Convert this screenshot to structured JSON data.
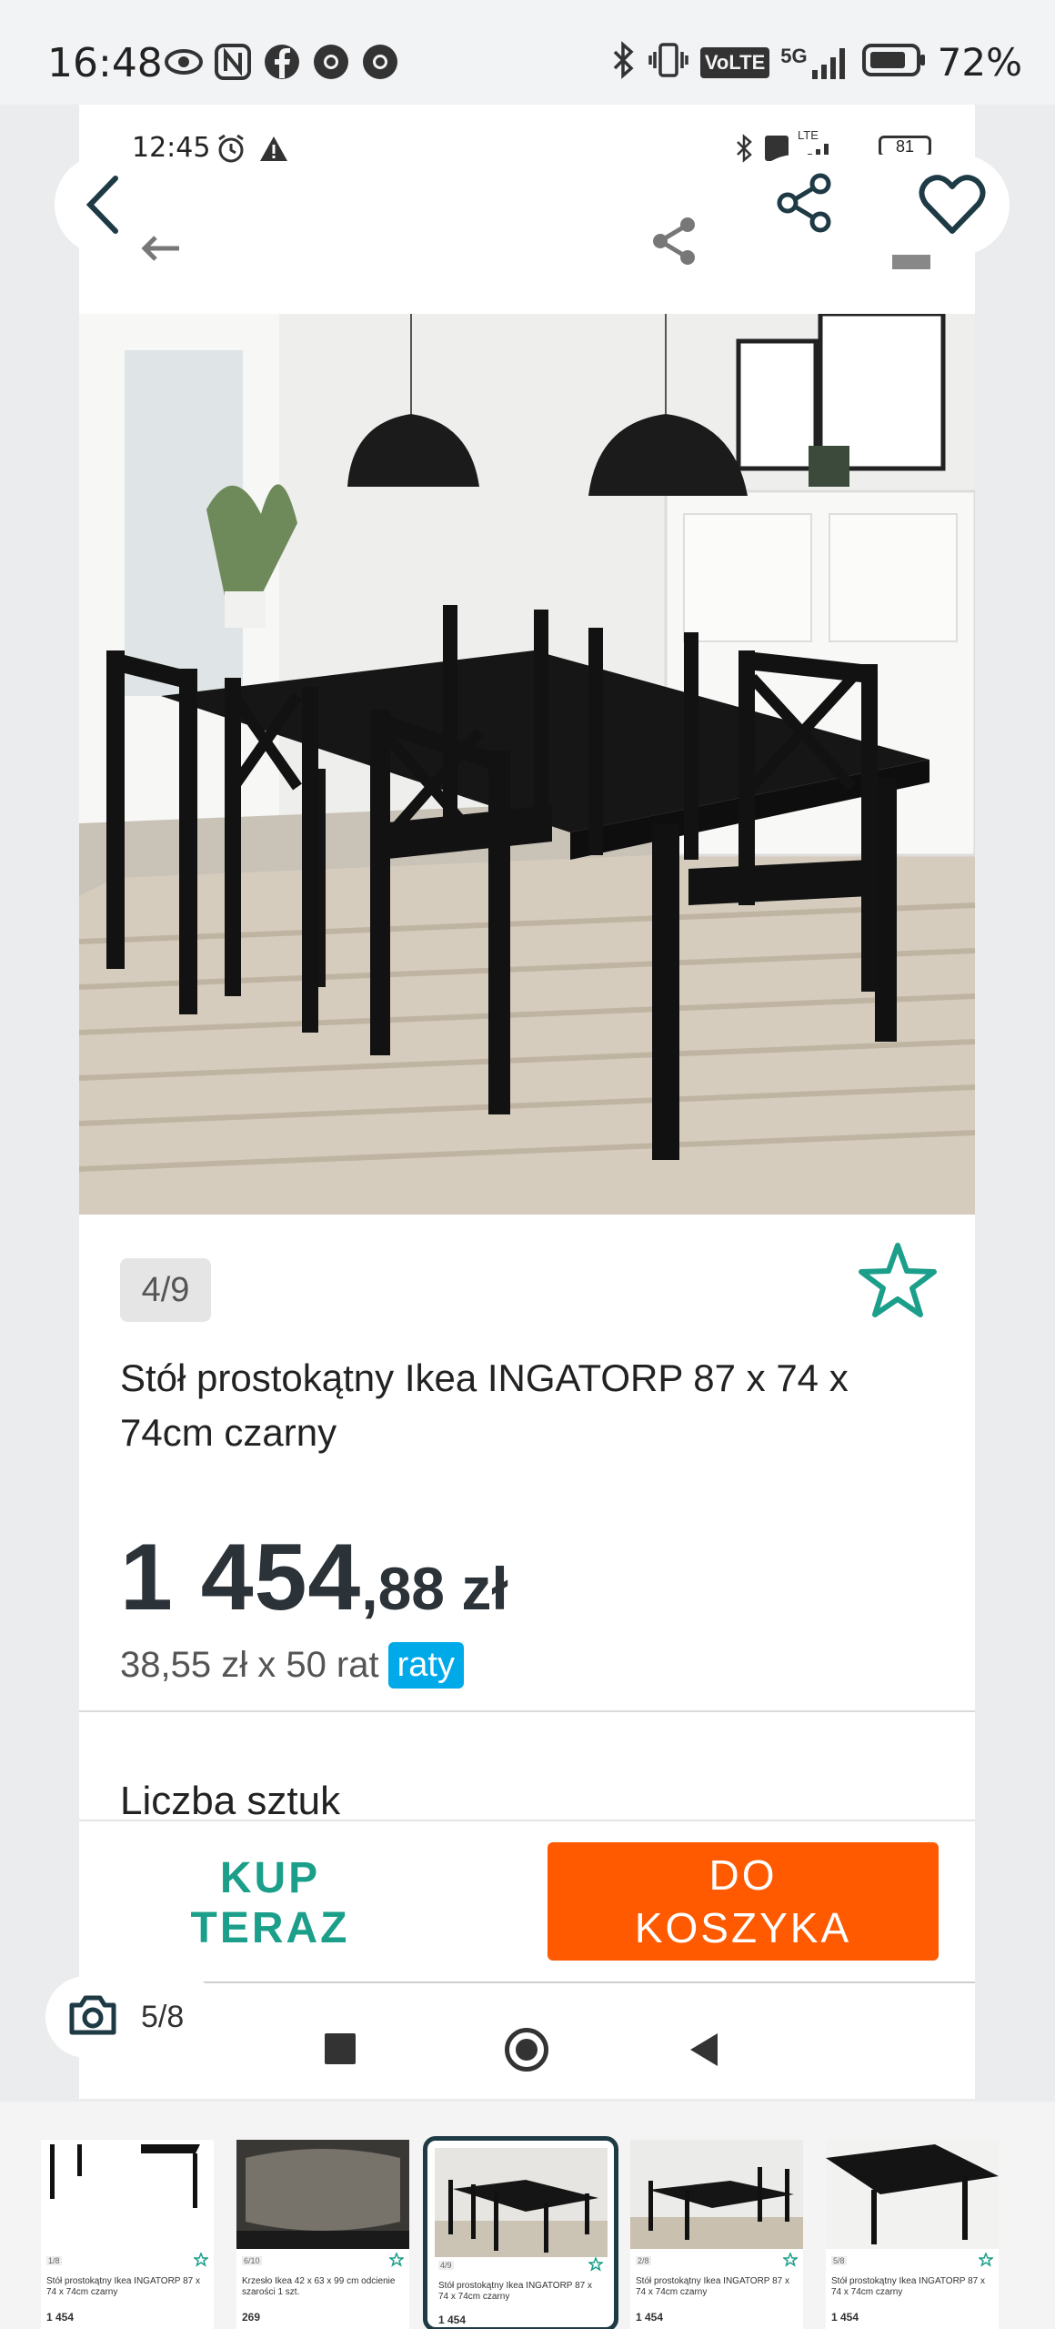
{
  "status_bar": {
    "time": "16:48",
    "left_icons": [
      "eye-icon",
      "nfc-icon",
      "facebook-icon",
      "chrome-icon",
      "chrome-icon"
    ],
    "right_icons": [
      "bluetooth-icon",
      "vibrate-icon",
      "volte-icon",
      "signal-5g-icon",
      "battery-icon"
    ],
    "volte": "VoLTE",
    "network": "5G",
    "battery": "72%"
  },
  "inner_status": {
    "time": "12:45",
    "network": "LTE",
    "battery": "81"
  },
  "product": {
    "image_counter": "4/9",
    "title": "Stół prostokątny Ikea INGATORP 87 x 74 x 74cm czarny",
    "price_main": "1 454",
    "price_fraction": ",88 zł",
    "installment_text": "38,55 zł x 50 rat",
    "installment_badge": "raty",
    "quantity_label": "Liczba sztuk",
    "buy_now": "KUP TERAZ",
    "add_to_cart": "DO\nKOSZYKA"
  },
  "overlay": {
    "photo_counter": "5/8"
  },
  "thumbnails": [
    {
      "counter": "1/8",
      "title": "Stół prostokątny Ikea INGATORP 87 x 74 x 74cm czarny",
      "price": "1 454"
    },
    {
      "counter": "6/10",
      "title": "Krzesło Ikea 42 x 63 x 99 cm odcienie szarości 1 szt.",
      "price": "269"
    },
    {
      "counter": "4/9",
      "title": "Stół prostokątny Ikea INGATORP 87 x 74 x 74cm czarny",
      "price": "1 454"
    },
    {
      "counter": "2/8",
      "title": "Stół prostokątny Ikea INGATORP 87 x 74 x 74cm czarny",
      "price": "1 454"
    },
    {
      "counter": "5/8",
      "title": "Stół prostokątny Ikea INGATORP 87 x 74 x 74cm czarny",
      "price": "1 454"
    }
  ],
  "colors": {
    "accent_teal": "#1b9f8a",
    "cart_orange": "#ff5a00",
    "raty_blue": "#00a9e8",
    "selected_border": "#1e3a44"
  }
}
